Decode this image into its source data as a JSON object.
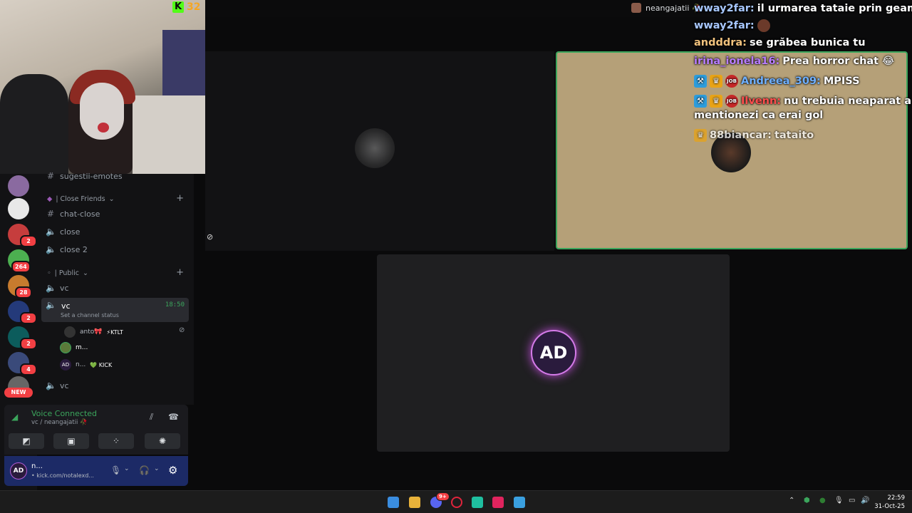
{
  "window": {
    "title": "neangajatii 🥀"
  },
  "stream": {
    "platform_count": "32"
  },
  "servers": [
    {
      "badge": ""
    },
    {
      "badge": ""
    },
    {
      "badge": "2"
    },
    {
      "badge": "264"
    },
    {
      "badge": "28"
    },
    {
      "badge": "2"
    },
    {
      "badge": "2"
    },
    {
      "badge": "4"
    },
    {
      "badge": ""
    }
  ],
  "new_label": "NEW",
  "channels": {
    "top_channel": "sugestii-emotes",
    "categories": [
      {
        "label": "| Close Friends",
        "items": [
          "chat-close",
          "close",
          "close 2"
        ]
      },
      {
        "label": "| Public",
        "items": [
          "vc"
        ]
      }
    ],
    "active_vc": {
      "name": "vc",
      "time": "18:50",
      "status": "Set a channel status"
    },
    "members": [
      {
        "name": "anto🎀",
        "tag": "⚡KTLT"
      },
      {
        "name": "m..."
      },
      {
        "name": "n...",
        "tag": "💚 KICK"
      }
    ],
    "last_vc": "vc"
  },
  "voice": {
    "title": "Voice Connected",
    "subtitle": "vc / neangajatii 🥀"
  },
  "user": {
    "name": "n...",
    "status": "• kick.com/notalexd..."
  },
  "chat": [
    {
      "user": "wway2far:",
      "text": "il urmarea tataie prin geam",
      "color": "#a7c7ff"
    },
    {
      "user": "wway2far:",
      "text": "",
      "color": "#a7c7ff"
    },
    {
      "user": "andddra:",
      "text": "se grăbea bunica tu",
      "color": "#f1c27d"
    },
    {
      "user": "irina_ionela16:",
      "text": "Prea horror chat 😂",
      "color": "#b87cff"
    },
    {
      "user": "Andreea_309:",
      "text": "MPISS",
      "color": "#6fb0ff"
    },
    {
      "user": "Ilvenn:",
      "text": "nu trebuia neaparat a",
      "text2": "mentionezi ca erai gol",
      "color": "#ff4d4d"
    },
    {
      "user": "88biancar:",
      "text": "tataito",
      "color": "#ffffff"
    }
  ],
  "tile3_logo": "AD",
  "taskbar": {
    "time": "22:59",
    "date": "31-Oct-25",
    "discord_badge": "9+"
  }
}
